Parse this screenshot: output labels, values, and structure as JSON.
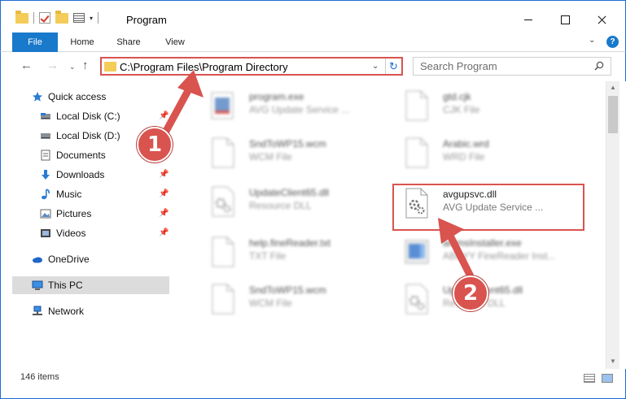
{
  "window": {
    "title": "Program",
    "minimize_glyph": "",
    "maximize_glyph": "",
    "close_glyph": ""
  },
  "ribbon": {
    "tabs": [
      "File",
      "Home",
      "Share",
      "View"
    ],
    "expand_glyph": "⌄",
    "help_glyph": "?"
  },
  "address": {
    "path": "C:\\Program Files\\Program Directory",
    "refresh_glyph": "↻",
    "dropdown_glyph": "⌄"
  },
  "nav": {
    "back_glyph": "←",
    "forward_glyph": "→",
    "recent_glyph": "⌄",
    "up_glyph": "↑"
  },
  "search": {
    "placeholder": "Search Program"
  },
  "sidebar": {
    "items": [
      {
        "label": "Quick access",
        "icon": "star-icon",
        "pinned": false
      },
      {
        "label": "Local Disk (C:)",
        "icon": "drive-icon",
        "pinned": true
      },
      {
        "label": "Local Disk (D:)",
        "icon": "drive-icon",
        "pinned": false
      },
      {
        "label": "Documents",
        "icon": "documents-icon",
        "pinned": true
      },
      {
        "label": "Downloads",
        "icon": "downloads-icon",
        "pinned": true
      },
      {
        "label": "Music",
        "icon": "music-icon",
        "pinned": true
      },
      {
        "label": "Pictures",
        "icon": "pictures-icon",
        "pinned": true
      },
      {
        "label": "Videos",
        "icon": "videos-icon",
        "pinned": true
      },
      {
        "label": "OneDrive",
        "icon": "cloud-icon",
        "pinned": false
      },
      {
        "label": "This PC",
        "icon": "computer-icon",
        "pinned": false,
        "selected": true
      },
      {
        "label": "Network",
        "icon": "network-icon",
        "pinned": false
      }
    ],
    "pin_glyph": "📌"
  },
  "files": [
    {
      "name": "program.exe",
      "type": "AVG Update Service ...",
      "icon": "exe-icon",
      "blurred": true
    },
    {
      "name": "gtd.cjk",
      "type": "CJK File",
      "icon": "file-icon",
      "blurred": true
    },
    {
      "name": "SndToWP15.wcm",
      "type": "WCM File",
      "icon": "file-icon",
      "blurred": true
    },
    {
      "name": "Arabic.wrd",
      "type": "WRD File",
      "icon": "file-icon",
      "blurred": true
    },
    {
      "name": "UpdateClient65.dll",
      "type": "Resource DLL",
      "icon": "dll-gear-icon",
      "blurred": true
    },
    {
      "name": "avgupsvc.dll",
      "type": "AVG Update Service ...",
      "icon": "dll-gear-icon",
      "blurred": false,
      "highlighted": true
    },
    {
      "name": "help.fineReader.txt",
      "type": "TXT File",
      "icon": "file-icon",
      "blurred": true
    },
    {
      "name": "ammsInstaller.exe",
      "type": "ABBYY FineReader Inst...",
      "icon": "installer-icon",
      "blurred": true
    },
    {
      "name": "SndToWP15.wcm",
      "type": "WCM File",
      "icon": "file-icon",
      "blurred": true
    },
    {
      "name": "UpdateClient65.dll",
      "type": "Resource DLL",
      "icon": "dll-gear-icon",
      "blurred": true
    }
  ],
  "status": {
    "item_count": "146 items"
  },
  "callouts": [
    {
      "number": "1"
    },
    {
      "number": "2"
    }
  ],
  "colors": {
    "accent": "#1979ca",
    "highlight": "#d9534f",
    "folder": "#f3cc5a"
  }
}
